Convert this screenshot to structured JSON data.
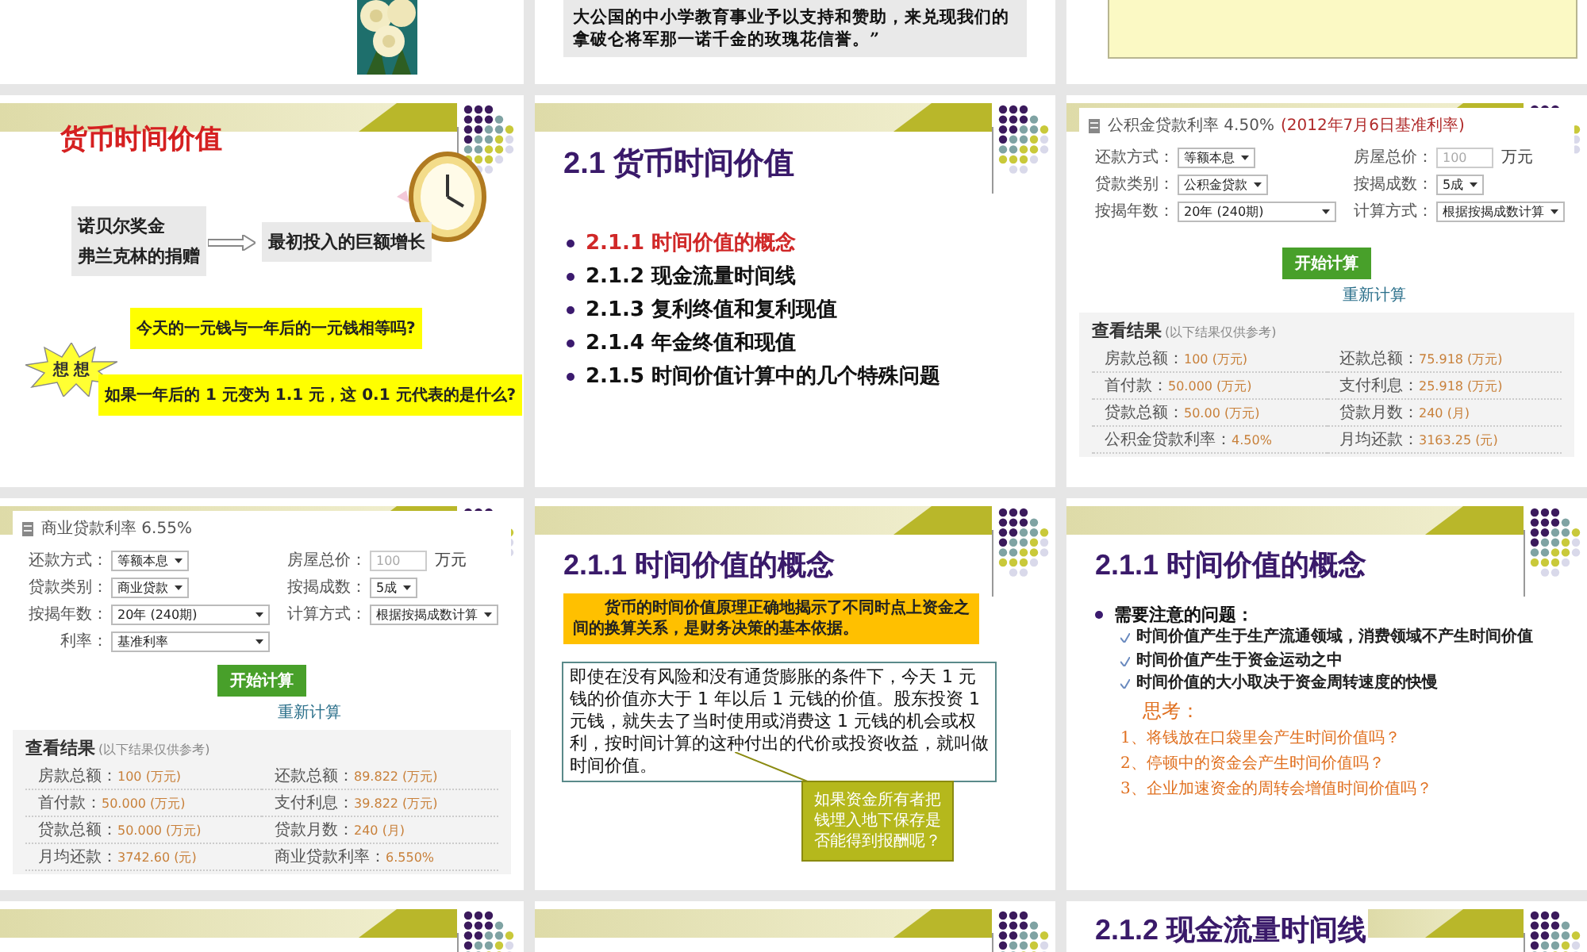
{
  "slides": [
    {
      "kind": "roses"
    },
    {
      "kind": "quote",
      "lines": [
        "大公国的中小学教育事业予以支持和赞助，来兑现我们的",
        "拿破仑将军那一诺千金的玫瑰花信誉。”"
      ]
    },
    {
      "kind": "note"
    },
    {
      "kind": "intro",
      "title": "货币时间价值",
      "donors": [
        "诺贝尔奖金",
        "弗兰克林的捐赠"
      ],
      "growth": "最初投入的巨额增长",
      "question": "今天的一元钱与一年后的一元钱相等吗?",
      "burst": "想 想",
      "question2": "如果一年后的 1 元变为 1.1 元，这 0.1 元代表的是什么?"
    },
    {
      "kind": "outline",
      "title": "2.1  货币时间价值",
      "items": [
        {
          "text": "2.1.1  时间价值的概念",
          "selected": true
        },
        {
          "text": "2.1.2  现金流量时间线",
          "selected": false
        },
        {
          "text": "2.1.3  复利终值和复利现值",
          "selected": false
        },
        {
          "text": "2.1.4  年金终值和现值",
          "selected": false
        },
        {
          "text": "2.1.5  时间价值计算中的几个特殊问题",
          "selected": false
        }
      ]
    },
    {
      "kind": "calculator",
      "rate": "公积金贷款利率 4.50%",
      "rate_note": "(2012年7月6日基准利率)",
      "fields": [
        {
          "label": "还款方式：",
          "value": "等额本息",
          "kind": "select"
        },
        {
          "label": "房屋总价：",
          "placeholder": "100",
          "kind": "input",
          "unit": "万元"
        },
        {
          "label": "贷款类别：",
          "value": "公积金贷款",
          "kind": "select"
        },
        {
          "label": "按揭成数：",
          "value": "5成",
          "kind": "select"
        },
        {
          "label": "按揭年数：",
          "value": "20年 (240期)",
          "kind": "select"
        },
        {
          "label": "计算方式：",
          "value": "根据按揭成数计算",
          "kind": "select"
        }
      ],
      "button": "开始计算",
      "reset": "重新计算",
      "results_title": "查看结果",
      "results_note": "(以下结果仅供参考)",
      "results": [
        {
          "label": "房款总额：",
          "value": "100 (万元)"
        },
        {
          "label": "还款总额：",
          "value": "75.918 (万元)"
        },
        {
          "label": "首付款：",
          "value": "50.000 (万元)"
        },
        {
          "label": "支付利息：",
          "value": "25.918 (万元)"
        },
        {
          "label": "贷款总额：",
          "value": "50.00 (万元)"
        },
        {
          "label": "贷款月数：",
          "value": "240 (月)"
        },
        {
          "label": "公积金贷款利率：",
          "value": "4.50%"
        },
        {
          "label": "月均还款：",
          "value": "3163.25 (元)"
        }
      ]
    },
    {
      "kind": "calculator",
      "rate": "商业贷款利率 6.55%",
      "fields": [
        {
          "label": "还款方式：",
          "value": "等额本息",
          "kind": "select"
        },
        {
          "label": "房屋总价：",
          "placeholder": "100",
          "kind": "input",
          "unit": "万元"
        },
        {
          "label": "贷款类别：",
          "value": "商业贷款",
          "kind": "select"
        },
        {
          "label": "按揭成数：",
          "value": "5成",
          "kind": "select"
        },
        {
          "label": "按揭年数：",
          "value": "20年 (240期)",
          "kind": "select"
        },
        {
          "label": "计算方式：",
          "value": "根据按揭成数计算",
          "kind": "select"
        },
        {
          "label": "利率：",
          "value": "基准利率",
          "kind": "select"
        }
      ],
      "button": "开始计算",
      "reset": "重新计算",
      "results_title": "查看结果",
      "results_note": "(以下结果仅供参考)",
      "results": [
        {
          "label": "房款总额：",
          "value": "100 (万元)"
        },
        {
          "label": "还款总额：",
          "value": "89.822 (万元)"
        },
        {
          "label": "首付款：",
          "value": "50.000 (万元)"
        },
        {
          "label": "支付利息：",
          "value": "39.822 (万元)"
        },
        {
          "label": "贷款总额：",
          "value": "50.000 (万元)"
        },
        {
          "label": "贷款月数：",
          "value": "240 (月)"
        },
        {
          "label": "月均还款：",
          "value": "3742.60 (元)"
        },
        {
          "label": "商业贷款利率：",
          "value": "6.550%"
        }
      ]
    },
    {
      "kind": "concept",
      "title": "2.1.1  时间价值的概念",
      "highlight": "货币的时间价值原理正确地揭示了不同时点上资金之间的换算关系，是财务决策的基本依据。",
      "body": "即使在没有风险和没有通货膨胀的条件下，今天 1 元钱的价值亦大于 1 年以后 1 元钱的价值。股东投资 1 元钱，就失去了当时使用或消费这 1 元钱的机会或权利，按时间计算的这种付出的代价或投资收益，就叫做时间价值。",
      "callout": "如果资金所有者把钱埋入地下保存是否能得到报酬呢？"
    },
    {
      "kind": "notes",
      "title": "2.1.1  时间价值的概念",
      "heading": "需要注意的问题：",
      "checks": [
        "时间价值产生于生产流通领域，消费领域不产生时间价值",
        "时间价值产生于资金运动之中",
        "时间价值的大小取决于资金周转速度的快慢"
      ],
      "think": "思考：",
      "questions": [
        "1、将钱放在口袋里会产生时间价值吗？",
        "2、停顿中的资金会产生时间价值吗？",
        "3、企业加速资金的周转会增值时间价值吗？"
      ]
    },
    {
      "kind": "blank"
    },
    {
      "kind": "blank"
    },
    {
      "kind": "title",
      "title": "2.1.2  现金流量时间线"
    }
  ]
}
